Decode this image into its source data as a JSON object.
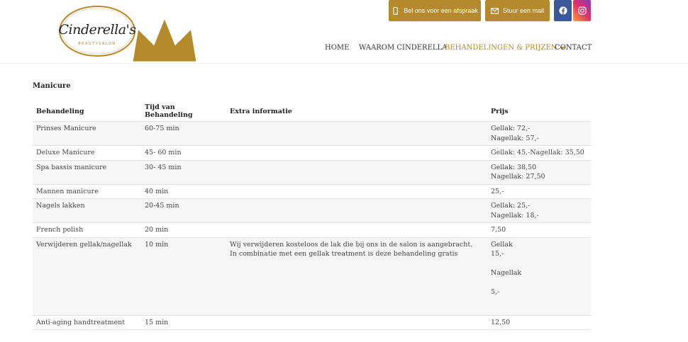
{
  "brand": {
    "name": "Cinderella's",
    "subtitle": "BEAUTYSALON",
    "gold": "#b48a2c"
  },
  "topbar": {
    "call_label": "Bel ons voor een afspraak",
    "mail_label": "Stuur een mail",
    "facebook_icon": "facebook-icon",
    "instagram_icon": "instagram-icon"
  },
  "nav": {
    "home": "HOME",
    "waarom": "WAAROM CINDERELLA",
    "behandelingen": "BEHANDELINGEN & PRIJZEN",
    "contact": "CONTACT"
  },
  "section": {
    "title": "Manicure"
  },
  "table": {
    "headers": [
      "Behandeling",
      "Tijd van Behandeling",
      "Extra informatie",
      "Prijs"
    ],
    "rows": [
      {
        "name": "Prinses Manicure",
        "time": "60-75 min",
        "info": [],
        "price": [
          "Gellak: 72,-",
          "Nagellak: 57,-"
        ]
      },
      {
        "name": "Deluxe Manicure",
        "time": "45- 60 min",
        "info": [],
        "price": [
          "Gellak: 45,-Nagellak: 35,50"
        ]
      },
      {
        "name": "Spa bassis manicure",
        "time": "30- 45 min",
        "info": [],
        "price": [
          "Gellak: 38,50",
          "Nagellak: 27,50"
        ]
      },
      {
        "name": "Mannen manicure",
        "time": "40 min",
        "info": [],
        "price": [
          "25,-"
        ]
      },
      {
        "name": "Nagels lakken",
        "time": "20-45 min",
        "info": [],
        "price": [
          "Gellak: 25,-",
          "Nagellak: 18,-"
        ]
      },
      {
        "name": "French polish",
        "time": "20 min",
        "info": [],
        "price": [
          "7,50"
        ]
      },
      {
        "name": "Verwijderen gellak/nagellak",
        "time": "10 min",
        "info": [
          "Wij verwijderen kosteloos de lak die bij ons in de salon is aangebracht.",
          "In combinatie met een gellak treatment is deze behandeling gratis"
        ],
        "price": [
          "Gellak",
          "15,-",
          "",
          "Nagellak",
          "",
          "5,-"
        ]
      },
      {
        "name": "Anti-aging handtreatment",
        "time": "15 min",
        "info": [],
        "price": [
          "12,50"
        ]
      }
    ]
  }
}
